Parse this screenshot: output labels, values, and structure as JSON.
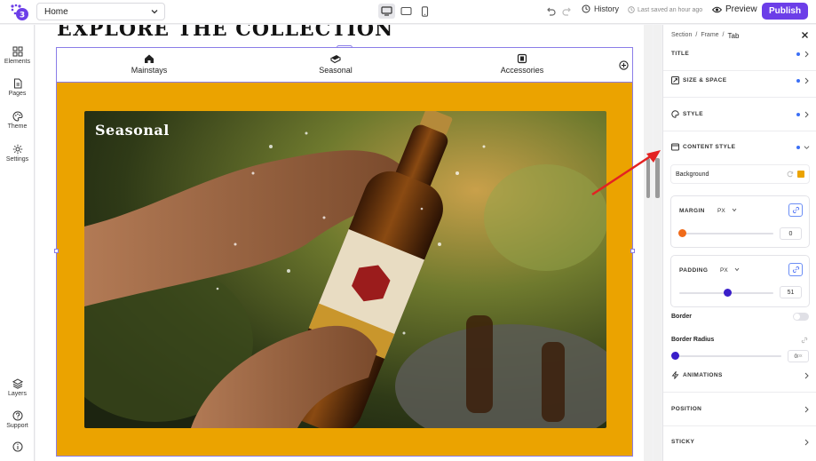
{
  "topbar": {
    "page_name": "Home",
    "history_label": "History",
    "saved_label": "Last saved an hour ago",
    "preview_label": "Preview",
    "publish_label": "Publish"
  },
  "leftbar": {
    "elements": "Elements",
    "pages": "Pages",
    "theme": "Theme",
    "settings": "Settings",
    "layers": "Layers",
    "support": "Support"
  },
  "canvas": {
    "heading": "EXPLORE THE COLLECTION",
    "tabs": [
      {
        "label": "Mainstays",
        "icon": "home-icon"
      },
      {
        "label": "Seasonal",
        "icon": "fire-icon"
      },
      {
        "label": "Accessories",
        "icon": "box-icon"
      }
    ],
    "active_tab": "Seasonal",
    "panel_title": "Seasonal",
    "panel_color": "#eba300"
  },
  "rightpanel": {
    "breadcrumb": [
      "Section",
      "Frame",
      "Tab"
    ],
    "sections": {
      "title": "TITLE",
      "size_space": "SIZE & SPACE",
      "style": "STYLE",
      "content_style": "CONTENT STYLE",
      "animations": "ANIMATIONS",
      "position": "POSITION",
      "sticky": "STICKY"
    },
    "background_label": "Background",
    "margin": {
      "label": "MARGIN",
      "unit": "PX",
      "value": "0",
      "fraction": 0.0
    },
    "padding": {
      "label": "PADDING",
      "unit": "PX",
      "value": "51",
      "fraction": 0.51
    },
    "border_label": "Border",
    "border_radius": {
      "label": "Border Radius",
      "value": "0",
      "unit": "px",
      "fraction": 0.0
    },
    "accent_color": "#6c3ee8",
    "dot_color": "#3b6ff5"
  }
}
